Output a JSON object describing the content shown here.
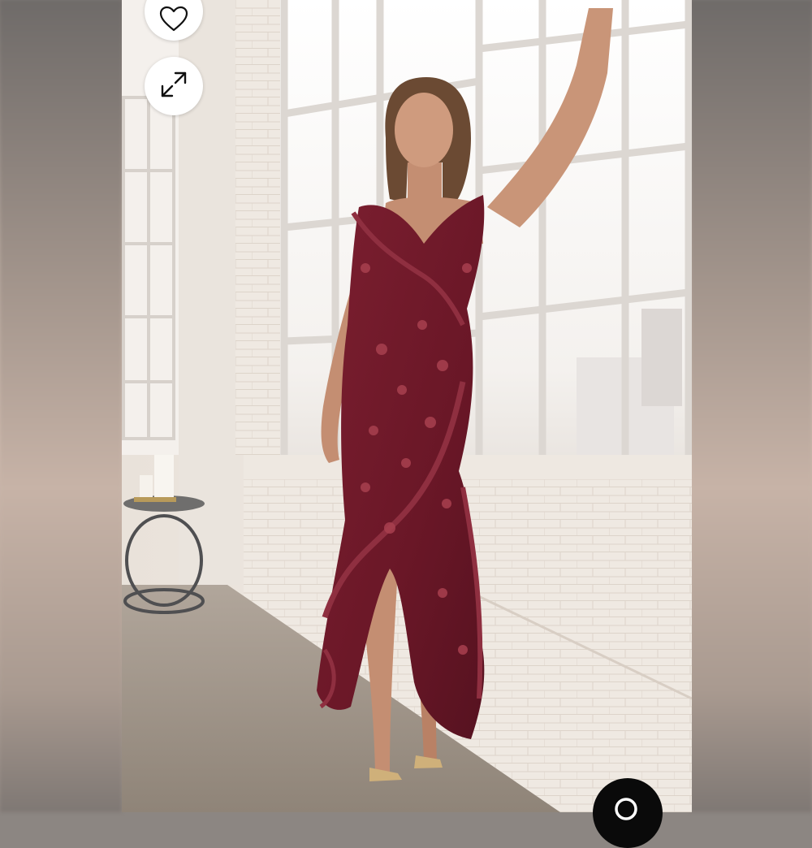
{
  "viewer": {
    "photo_subject": "burgundy-floral-ruffle-maxi-dress",
    "accent_color": "#6e1a2a"
  },
  "actions": {
    "favorite_icon": "heart-icon",
    "expand_icon": "expand-arrows-icon",
    "search_icon": "search-icon"
  }
}
